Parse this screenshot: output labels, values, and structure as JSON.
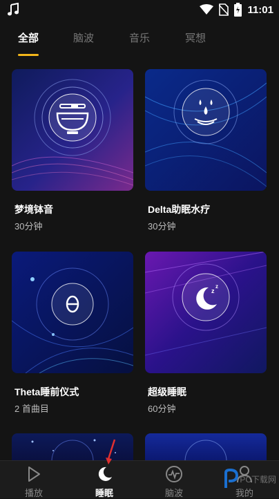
{
  "status_bar": {
    "time": "11:01",
    "icons": [
      "music-note-icon",
      "wifi-icon",
      "no-sim-icon",
      "battery-charging-icon"
    ]
  },
  "tabs": [
    {
      "label": "全部",
      "active": true
    },
    {
      "label": "脑波",
      "active": false
    },
    {
      "label": "音乐",
      "active": false
    },
    {
      "label": "冥想",
      "active": false
    }
  ],
  "cards": [
    {
      "title": "梦境钵音",
      "subtitle": "30分钟",
      "icon": "singing-bowl-icon"
    },
    {
      "title": "Delta助眠水疗",
      "subtitle": "30分钟",
      "icon": "water-drops-icon"
    },
    {
      "title": "Theta睡前仪式",
      "subtitle": "2 首曲目",
      "icon": "theta-icon"
    },
    {
      "title": "超级睡眠",
      "subtitle": "60分钟",
      "icon": "moon-zzz-icon"
    }
  ],
  "bottom_nav": [
    {
      "label": "播放",
      "icon": "play-icon",
      "active": false
    },
    {
      "label": "睡眠",
      "icon": "moon-icon",
      "active": true
    },
    {
      "label": "脑波",
      "icon": "brainwave-icon",
      "active": false
    },
    {
      "label": "我的",
      "icon": "user-icon",
      "active": false
    }
  ],
  "watermark": {
    "text": "PC下载网"
  },
  "colors": {
    "accent": "#f3b61a",
    "background": "#141414",
    "nav_background": "#1c1c1c",
    "arrow": "#e03030"
  }
}
